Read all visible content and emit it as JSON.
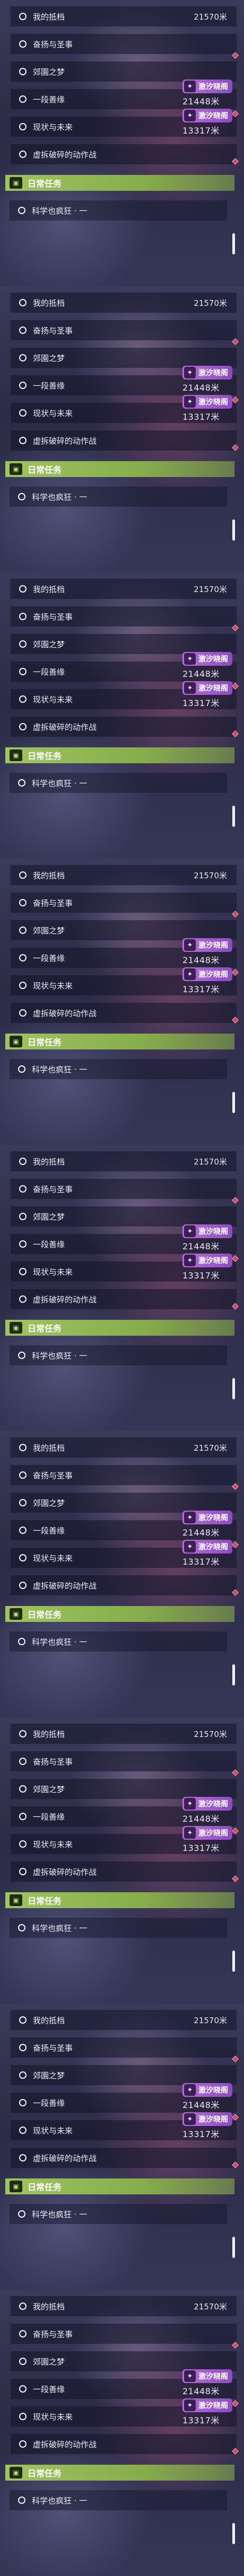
{
  "quests": [
    {
      "label": "我的抵档",
      "right": "21570米"
    },
    {
      "label": "奋扬与圣事"
    },
    {
      "label": "郊園之梦"
    },
    {
      "label": "一段善缘"
    },
    {
      "label": "现状与未来"
    },
    {
      "label": "虚拆破碎的动作战"
    }
  ],
  "tracking": [
    {
      "tag": "激汐晓阁",
      "distance": "21448米"
    },
    {
      "tag": "激汐晓阁",
      "distance": "13317米"
    }
  ],
  "daily": {
    "label": "日常任务"
  },
  "daily_items": [
    {
      "label": "科学也疯狂 · 一"
    }
  ],
  "icons": {
    "tag_icon": "✦",
    "banner_icon": "▣"
  }
}
